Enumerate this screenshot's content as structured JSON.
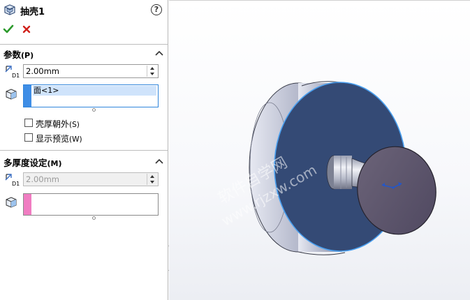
{
  "property_manager": {
    "title": "抽壳1",
    "help": "?",
    "ok_icon": "check-icon",
    "cancel_icon": "x-icon",
    "parameters": {
      "title": "参数",
      "key": "(P)",
      "thickness": "2.00mm",
      "faces_to_remove": [
        "面<1>"
      ],
      "swatch_color": "#3f8ee6",
      "selected_bg": "#cfe3fb",
      "shell_outward": {
        "label": "壳厚朝外",
        "key": "(S)",
        "checked": false
      },
      "show_preview": {
        "label": "显示预览",
        "key": "(W)",
        "checked": false
      }
    },
    "multi_thickness": {
      "title": "多厚度设定",
      "key": "(M)",
      "thickness": "2.00mm",
      "faces": [],
      "swatch_color": "#f07dc2"
    }
  },
  "graphics": {
    "selected_face_color": "#344a75",
    "highlight_edge_color": "#4aa0f0",
    "body_color": "#c9ccd8",
    "watermark": [
      "软件自学网",
      "www.rjzxw.com"
    ]
  }
}
